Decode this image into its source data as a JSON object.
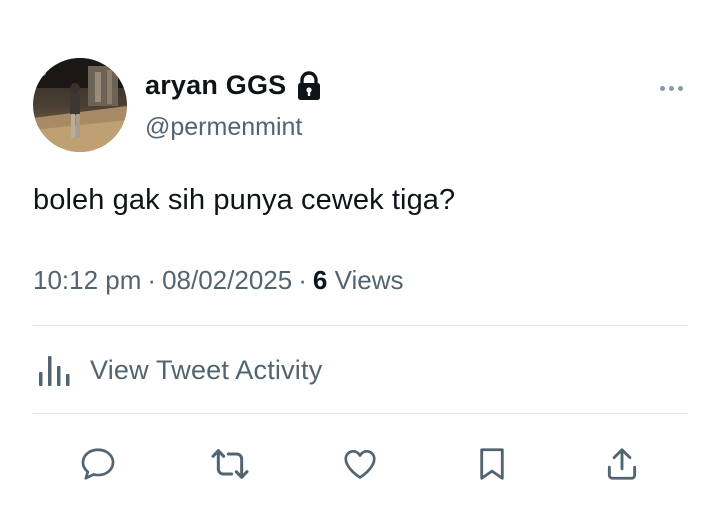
{
  "tweet": {
    "display_name": "aryan GGS",
    "handle": "@permenmint",
    "text": "boleh gak sih punya cewek tiga?",
    "time": "10:12 pm",
    "date": "08/02/2025",
    "separator": "·",
    "views_count": "6",
    "views_label": "Views",
    "activity_label": "View Tweet Activity"
  },
  "icons": {
    "lock": "lock-icon",
    "more": "more-dots-icon",
    "activity": "bar-chart-icon",
    "reply": "speech-bubble-icon",
    "retweet": "retweet-icon",
    "like": "heart-icon",
    "bookmark": "bookmark-icon",
    "share": "share-upload-icon"
  },
  "colors": {
    "text_primary": "#0f1419",
    "text_secondary": "#536471",
    "divider": "#dfe3e6"
  }
}
